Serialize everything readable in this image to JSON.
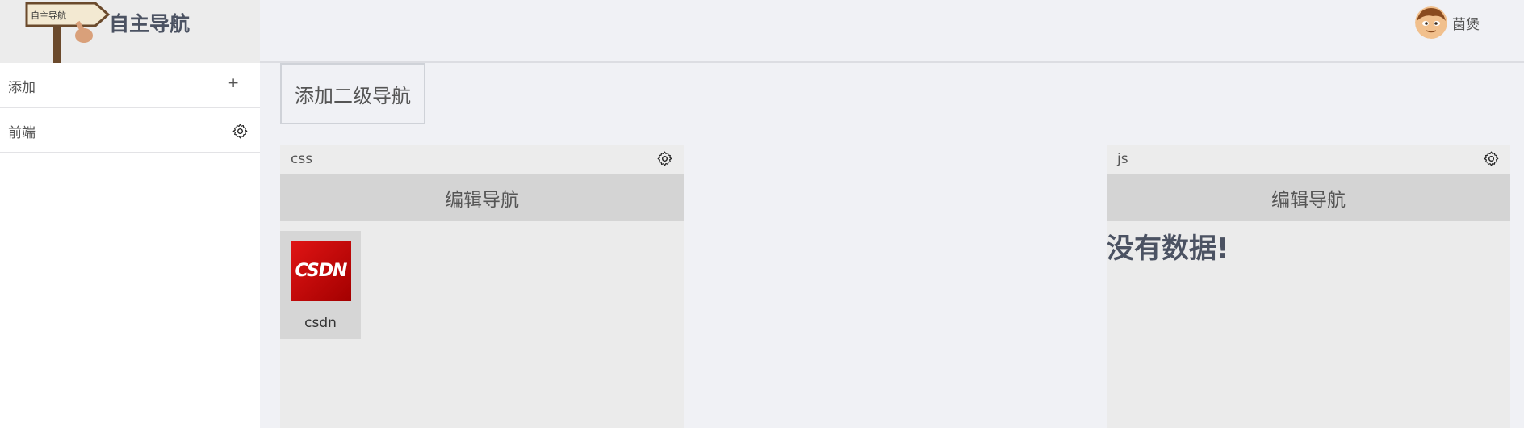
{
  "header": {
    "app_title": "自主导航",
    "user": {
      "name": "菌煲"
    }
  },
  "sidebar": {
    "items": [
      {
        "label": "添加",
        "icon": "plus-icon",
        "symbol": "+"
      },
      {
        "label": "前端",
        "icon": "gear-icon"
      }
    ]
  },
  "main": {
    "add_secondary_label": "添加二级导航",
    "panels": [
      {
        "name": "css",
        "edit_label": "编辑导航",
        "links": [
          {
            "label": "csdn",
            "icon_text": "CSDN"
          }
        ]
      },
      {
        "name": "js",
        "edit_label": "编辑导航",
        "empty_text": "没有数据!"
      }
    ]
  },
  "colors": {
    "page_bg": "#f0f1f5",
    "sidebar_bg": "#ffffff",
    "panel_bg": "#ebebeb",
    "edit_bar_bg": "#d4d4d4",
    "title_color": "#4b5262",
    "csdn_red": "#d40000"
  }
}
